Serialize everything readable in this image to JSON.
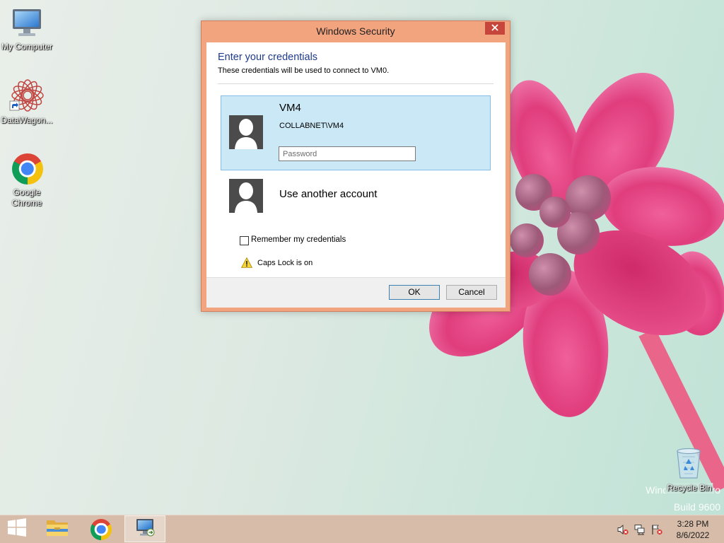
{
  "desktop": {
    "icons": [
      {
        "label": "My Computer",
        "icon": "computer-icon"
      },
      {
        "label": "DataWagon...",
        "icon": "datawagon-icon"
      },
      {
        "label": "Google Chrome",
        "icon": "chrome-icon"
      }
    ],
    "recycle_bin": {
      "label": "Recycle Bin",
      "icon": "recycle-bin-icon"
    },
    "watermark": {
      "edition": "Windows 8.1 Pro",
      "build": "Build 9600"
    }
  },
  "dialog": {
    "title": "Windows Security",
    "close_icon": "close-icon",
    "heading": "Enter your credentials",
    "description": "These credentials will be used to connect to VM0.",
    "selected_account": {
      "name": "VM4",
      "user": "COLLABNET\\VM4",
      "password_placeholder": "Password",
      "password_value": "",
      "avatar_icon": "user-avatar-icon"
    },
    "other_account": {
      "label": "Use another account",
      "avatar_icon": "user-avatar-icon"
    },
    "remember_credentials": {
      "label": "Remember my credentials",
      "checked": false
    },
    "warning": {
      "text": "Caps Lock is on",
      "icon": "warning-icon"
    },
    "buttons": {
      "ok": "OK",
      "cancel": "Cancel"
    }
  },
  "taskbar": {
    "start_icon": "windows-logo-icon",
    "pinned": [
      {
        "icon": "file-explorer-icon",
        "active": false
      },
      {
        "icon": "chrome-icon",
        "active": false
      },
      {
        "icon": "remote-desktop-icon",
        "active": true
      }
    ],
    "tray_icons": [
      "volume-muted-icon",
      "network-icon",
      "action-center-flag-icon"
    ],
    "clock": {
      "time": "3:28 PM",
      "date": "8/6/2022"
    }
  },
  "colors": {
    "window_accent": "#f2a47f",
    "close_button": "#c7463b",
    "heading": "#1e3a8c",
    "selected_tile": "#cbe8f6",
    "selected_tile_border": "#86bde9",
    "taskbar": "#d7bda9",
    "default_button_border": "#3c7fb1"
  }
}
